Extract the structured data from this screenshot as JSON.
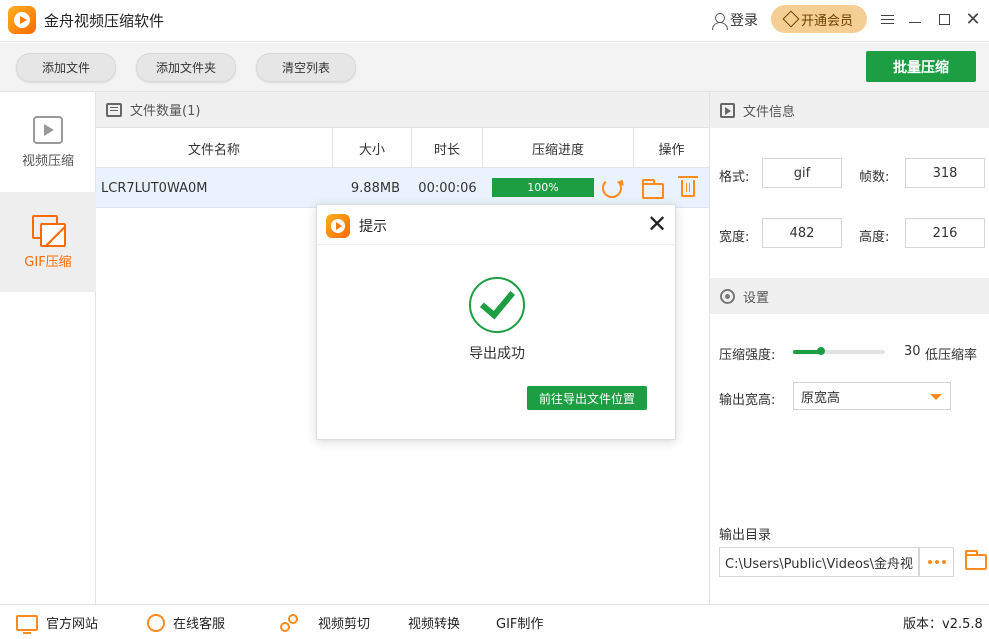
{
  "app": {
    "title": "金舟视频压缩软件"
  },
  "titlebar": {
    "login_label": "登录",
    "vip_label": "开通会员",
    "close_glyph": "✕"
  },
  "toolbar": {
    "add_file": "添加文件",
    "add_folder": "添加文件夹",
    "clear_list": "清空列表",
    "batch_compress": "批量压缩"
  },
  "sidebar": {
    "items": [
      {
        "label": "视频压缩",
        "icon": "play-icon",
        "active": false
      },
      {
        "label": "GIF压缩",
        "icon": "gif-icon",
        "active": true
      }
    ]
  },
  "file_list": {
    "count_label": "文件数量(1)",
    "columns": [
      "文件名称",
      "大小",
      "时长",
      "压缩进度",
      "操作"
    ],
    "rows": [
      {
        "name": "LCR7LUT0WA0M",
        "size": "9.88MB",
        "duration": "00:00:06",
        "progress_text": "100%",
        "progress": 1.0
      }
    ]
  },
  "file_info": {
    "title": "文件信息",
    "format_label": "格式:",
    "format_value": "gif",
    "frames_label": "帧数:",
    "frames_value": "318",
    "width_label": "宽度:",
    "width_value": "482",
    "height_label": "高度:",
    "height_value": "216"
  },
  "settings": {
    "title": "设置",
    "strength_label": "压缩强度:",
    "strength_value": "30",
    "strength_level": 0.3,
    "strength_desc": "低压缩率",
    "output_size_label": "输出宽高:",
    "output_size_value": "原宽高",
    "output_dir_label": "输出目录",
    "output_dir_value": "C:\\Users\\Public\\Videos\\金舟视"
  },
  "statusbar": {
    "website": "官方网站",
    "support": "在线客服",
    "video_cut": "视频剪切",
    "video_convert": "视频转换",
    "gif_make": "GIF制作",
    "version": "版本：v2.5.8"
  },
  "dialog": {
    "title": "提示",
    "close_glyph": "✕",
    "message": "导出成功",
    "open_location_button": "前往导出文件位置"
  },
  "colors": {
    "accent_green": "#1e9e43",
    "accent_orange": "#ff8a1e",
    "vip_gold": "#f4cf94"
  }
}
